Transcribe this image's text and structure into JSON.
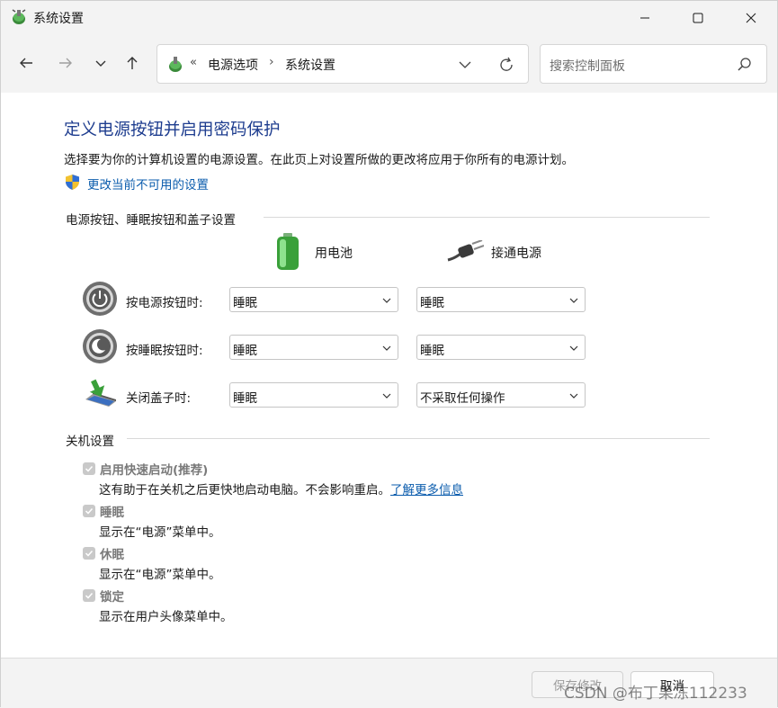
{
  "window": {
    "title": "系统设置"
  },
  "nav": {
    "breadcrumb_prefix": "«",
    "breadcrumb": [
      "电源选项",
      "系统设置"
    ],
    "breadcrumb_separator": "›",
    "search_placeholder": "搜索控制面板"
  },
  "page": {
    "heading": "定义电源按钮并启用密码保护",
    "description": "选择要为你的计算机设置的电源设置。在此页上对设置所做的更改将应用于你所有的电源计划。",
    "change_link": "更改当前不可用的设置"
  },
  "power_buttons": {
    "group_title": "电源按钮、睡眠按钮和盖子设置",
    "columns": [
      {
        "label": "用电池",
        "icon": "battery-icon"
      },
      {
        "label": "接通电源",
        "icon": "power-plug-icon"
      }
    ],
    "rows": [
      {
        "label": "按电源按钮时:",
        "icon": "power-button-icon",
        "battery": "睡眠",
        "plugged": "睡眠"
      },
      {
        "label": "按睡眠按钮时:",
        "icon": "sleep-button-icon",
        "battery": "睡眠",
        "plugged": "睡眠"
      },
      {
        "label": "关闭盖子时:",
        "icon": "laptop-lid-icon",
        "battery": "睡眠",
        "plugged": "不采取任何操作"
      }
    ]
  },
  "shutdown": {
    "group_title": "关机设置",
    "items": [
      {
        "label": "启用快速启动(推荐)",
        "desc": "这有助于在关机之后更快地启动电脑。不会影响重启。",
        "link": "了解更多信息",
        "checked": true
      },
      {
        "label": "睡眠",
        "desc": "显示在“电源”菜单中。",
        "checked": true
      },
      {
        "label": "休眠",
        "desc": "显示在“电源”菜单中。",
        "checked": true
      },
      {
        "label": "锁定",
        "desc": "显示在用户头像菜单中。",
        "checked": true
      }
    ]
  },
  "footer": {
    "save_label": "保存修改",
    "cancel_label": "取消"
  },
  "watermark": "CSDN @布丁果冻112233",
  "colors": {
    "heading": "#1e3d8f",
    "link": "#0b5cad",
    "disabled_text": "#7a7a7a"
  }
}
